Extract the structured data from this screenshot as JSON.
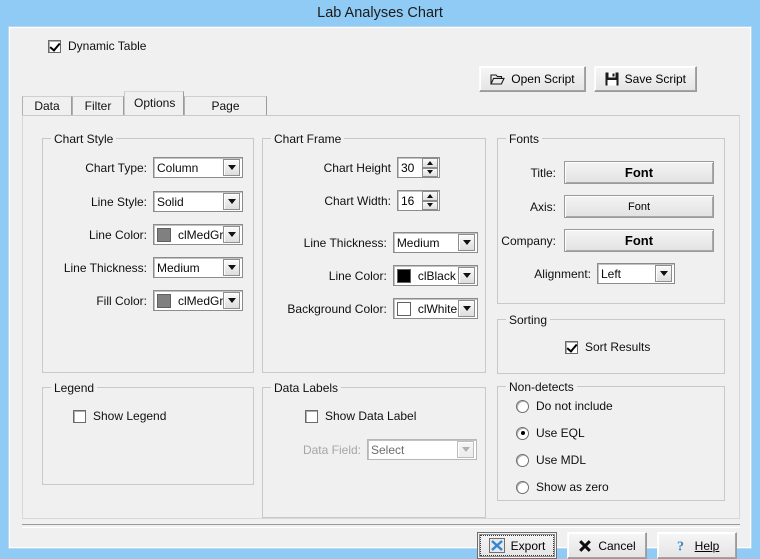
{
  "window": {
    "title": "Lab Analyses Chart"
  },
  "topbar": {
    "dynamic_table": {
      "label": "Dynamic Table",
      "checked": true
    },
    "open_script": {
      "label": "Open Script",
      "icon": "open-folder-icon"
    },
    "save_script": {
      "label": "Save Script",
      "icon": "floppy-disk-icon"
    }
  },
  "tabs": [
    {
      "label": "Data",
      "active": false
    },
    {
      "label": "Filter",
      "active": false
    },
    {
      "label": "Options",
      "active": true
    },
    {
      "label": "Page Layout",
      "active": false
    }
  ],
  "chart_style": {
    "legend": "Chart Style",
    "chart_type": {
      "label": "Chart Type:",
      "value": "Column"
    },
    "line_style": {
      "label": "Line Style:",
      "value": "Solid"
    },
    "line_color": {
      "label": "Line Color:",
      "value": "clMedGra",
      "swatch": "#808080"
    },
    "line_thickness": {
      "label": "Line Thickness:",
      "value": "Medium"
    },
    "fill_color": {
      "label": "Fill Color:",
      "value": "clMedGra",
      "swatch": "#808080"
    }
  },
  "chart_frame": {
    "legend": "Chart Frame",
    "chart_height": {
      "label": "Chart Height",
      "value": "30"
    },
    "chart_width": {
      "label": "Chart Width:",
      "value": "16"
    },
    "line_thickness": {
      "label": "Line Thickness:",
      "value": "Medium"
    },
    "line_color": {
      "label": "Line Color:",
      "value": "clBlack",
      "swatch": "#000000"
    },
    "background_color": {
      "label": "Background Color:",
      "value": "clWhite",
      "swatch": "#ffffff"
    }
  },
  "fonts": {
    "legend": "Fonts",
    "title": {
      "label": "Title:",
      "button": "Font"
    },
    "axis": {
      "label": "Axis:",
      "button": "Font"
    },
    "company": {
      "label": "Company:",
      "button": "Font"
    },
    "alignment": {
      "label": "Alignment:",
      "value": "Left"
    }
  },
  "sorting": {
    "legend": "Sorting",
    "sort_results": {
      "label": "Sort Results",
      "checked": true
    }
  },
  "non_detects": {
    "legend": "Non-detects",
    "options": [
      {
        "label": "Do not include",
        "selected": false
      },
      {
        "label": "Use EQL",
        "selected": true
      },
      {
        "label": "Use MDL",
        "selected": false
      },
      {
        "label": "Show as zero",
        "selected": false
      }
    ]
  },
  "legend_box": {
    "legend": "Legend",
    "show_legend": {
      "label": "Show Legend",
      "checked": false
    }
  },
  "data_labels": {
    "legend": "Data Labels",
    "show_data_label": {
      "label": "Show Data Label",
      "checked": false
    },
    "data_field": {
      "label": "Data Field:",
      "value": "Select",
      "disabled": true
    }
  },
  "bottombar": {
    "export": {
      "label": "Export",
      "icon": "excel-x-icon",
      "focused": true
    },
    "cancel": {
      "label": "Cancel",
      "icon": "x-cross-icon"
    },
    "help": {
      "label": "Help",
      "icon": "question-mark-icon"
    }
  },
  "colors": {
    "titlebar": "#8fcbf5",
    "dialog_face": "#f0f0f0",
    "group_border": "#c8c8c8"
  }
}
